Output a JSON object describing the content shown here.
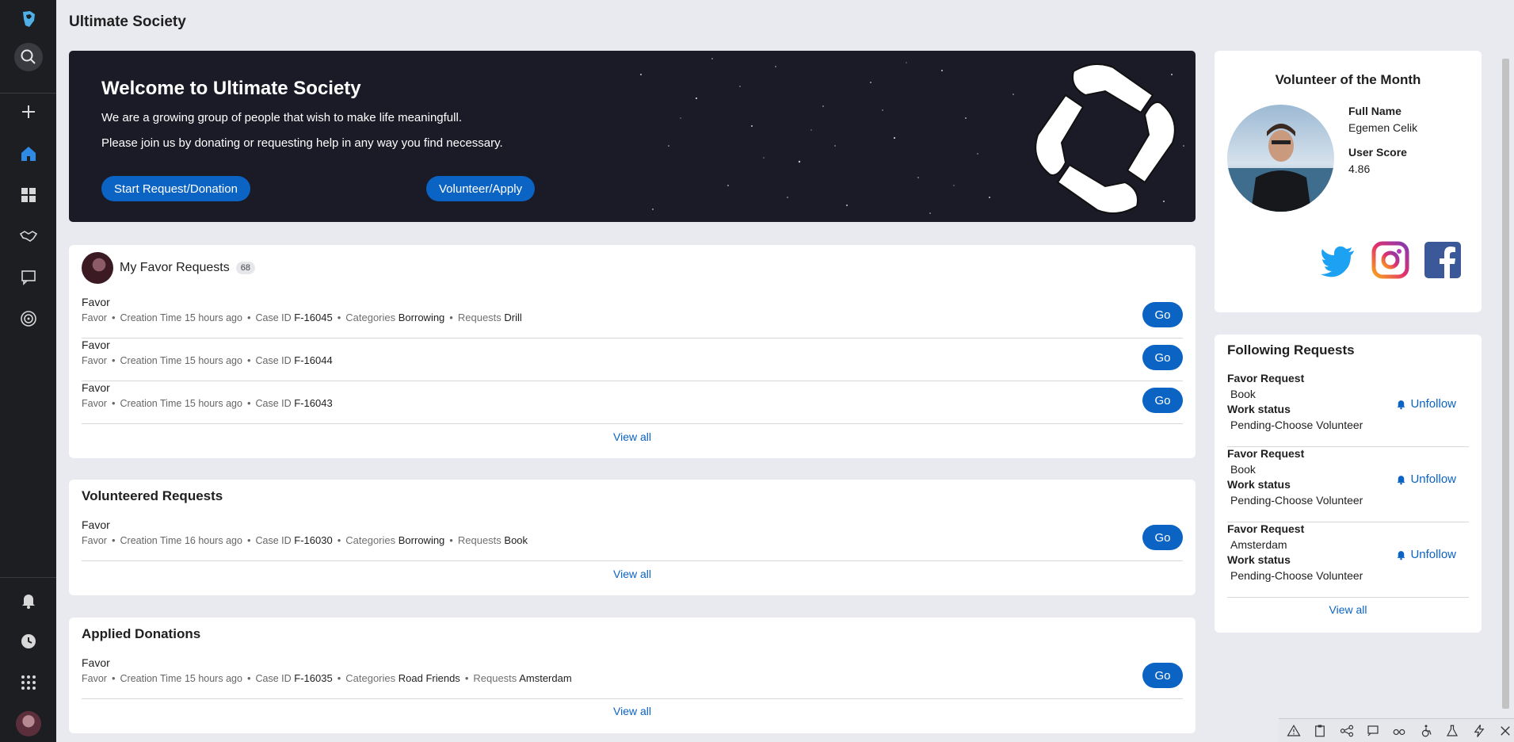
{
  "app": {
    "title": "Ultimate Society"
  },
  "sidebar": {
    "items": [
      {
        "icon": "logo-icon"
      },
      {
        "icon": "search-icon"
      },
      {
        "icon": "plus-icon"
      },
      {
        "icon": "home-icon"
      },
      {
        "icon": "dashboard-icon"
      },
      {
        "icon": "handshake-icon"
      },
      {
        "icon": "chat-icon"
      },
      {
        "icon": "target-icon"
      },
      {
        "icon": "bell-icon"
      },
      {
        "icon": "history-icon"
      },
      {
        "icon": "apps-icon"
      },
      {
        "icon": "avatar"
      }
    ]
  },
  "banner": {
    "heading": "Welcome to Ultimate Society",
    "line1": "We are a growing group of people that wish to make life meaningfull.",
    "line2": "Please join us by donating or requesting help in any way you find necessary.",
    "primary_button": "Start Request/Donation",
    "secondary_button": "Volunteer/Apply"
  },
  "my_favor_requests": {
    "title": "My Favor Requests",
    "count": "68",
    "rows": [
      {
        "title": "Favor",
        "type": "Favor",
        "creation_label": "Creation Time",
        "creation": "15 hours ago",
        "case_label": "Case ID",
        "case_id": "F-16045",
        "cat_label": "Categories",
        "category": "Borrowing",
        "req_label": "Requests",
        "request": "Drill",
        "go": "Go"
      },
      {
        "title": "Favor",
        "type": "Favor",
        "creation_label": "Creation Time",
        "creation": "15 hours ago",
        "case_label": "Case ID",
        "case_id": "F-16044",
        "go": "Go"
      },
      {
        "title": "Favor",
        "type": "Favor",
        "creation_label": "Creation Time",
        "creation": "15 hours ago",
        "case_label": "Case ID",
        "case_id": "F-16043",
        "go": "Go"
      }
    ],
    "view_all": "View all"
  },
  "volunteered_requests": {
    "title": "Volunteered Requests",
    "rows": [
      {
        "title": "Favor",
        "type": "Favor",
        "creation_label": "Creation Time",
        "creation": "16 hours ago",
        "case_label": "Case ID",
        "case_id": "F-16030",
        "cat_label": "Categories",
        "category": "Borrowing",
        "req_label": "Requests",
        "request": "Book",
        "go": "Go"
      }
    ],
    "view_all": "View all"
  },
  "applied_donations": {
    "title": "Applied Donations",
    "rows": [
      {
        "title": "Favor",
        "type": "Favor",
        "creation_label": "Creation Time",
        "creation": "15 hours ago",
        "case_label": "Case ID",
        "case_id": "F-16035",
        "cat_label": "Categories",
        "category": "Road Friends",
        "req_label": "Requests",
        "request": "Amsterdam",
        "go": "Go"
      }
    ],
    "view_all": "View all"
  },
  "volunteer_of_month": {
    "title": "Volunteer of the Month",
    "full_name_label": "Full Name",
    "full_name": "Egemen Celik",
    "score_label": "User Score",
    "score": "4.86",
    "social": [
      "twitter-icon",
      "instagram-icon",
      "facebook-icon"
    ]
  },
  "following_requests": {
    "title": "Following Requests",
    "items": [
      {
        "label1": "Favor Request",
        "value1": "Book",
        "label2": "Work status",
        "value2": "Pending-Choose Volunteer",
        "action": "Unfollow"
      },
      {
        "label1": "Favor Request",
        "value1": "Book",
        "label2": "Work status",
        "value2": "Pending-Choose Volunteer",
        "action": "Unfollow"
      },
      {
        "label1": "Favor Request",
        "value1": "Amsterdam",
        "label2": "Work status",
        "value2": "Pending-Choose Volunteer",
        "action": "Unfollow"
      }
    ],
    "view_all": "View all"
  },
  "devbar": {
    "icons": [
      "warning-icon",
      "clipboard-icon",
      "share-icon",
      "screen-icon",
      "glasses-icon",
      "accessibility-icon",
      "flask-icon",
      "bolt-icon",
      "close-icon"
    ]
  },
  "colors": {
    "primary": "#0b63c4",
    "sidebar": "#1d1e22",
    "background": "#e9eaef"
  }
}
